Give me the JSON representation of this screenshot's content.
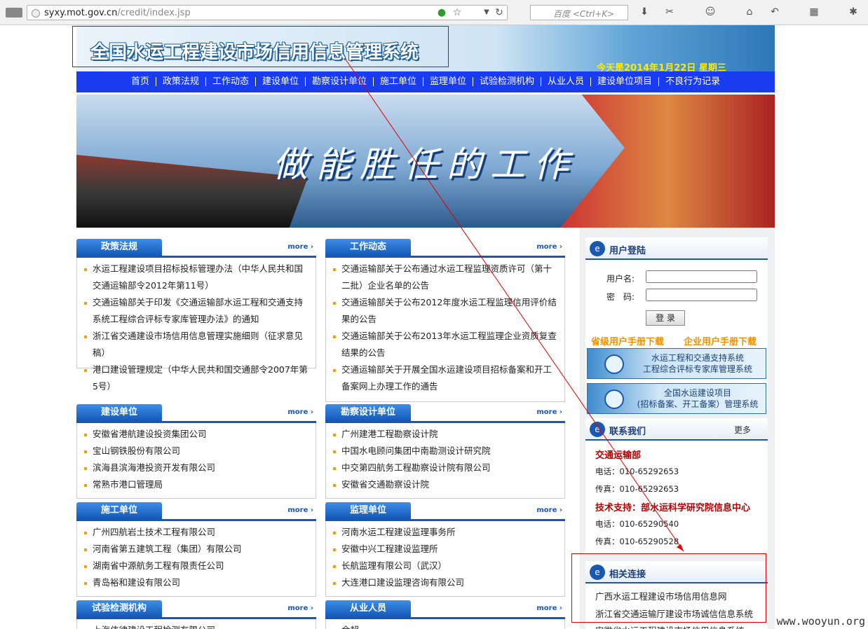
{
  "browser": {
    "url_host": "syxy.mot.gov.cn",
    "url_path": "/credit/index.jsp",
    "search_placeholder": "百度 <Ctrl+K>"
  },
  "header": {
    "title": "全国水运工程建设市场信用信息管理系统",
    "date": "今天是2014年1月22日 星期三"
  },
  "nav": [
    "首页",
    "政策法规",
    "工作动态",
    "建设单位",
    "勘察设计单位",
    "施工单位",
    "监理单位",
    "试验检测机构",
    "从业人员",
    "建设单位项目",
    "不良行为记录"
  ],
  "banner": {
    "slogan": "做能胜任的工作"
  },
  "more_label": "more ›",
  "sections": {
    "policy": {
      "title": "政策法规",
      "items": [
        "水运工程建设项目招标投标管理办法（中华人民共和国交通运输部令2012年第11号）",
        "交通运输部关于印发《交通运输部水运工程和交通支持系统工程综合评标专家库管理办法》的通知",
        "浙江省交通建设市场信用信息管理实施细则（征求意见稿）",
        "港口建设管理规定（中华人民共和国交通部令2007年第5号）"
      ]
    },
    "news": {
      "title": "工作动态",
      "items": [
        "交通运输部关于公布通过水运工程监理资质许可（第十二批）企业名单的公告",
        "交通运输部关于公布2012年度水运工程监理信用评价结果的公告",
        "交通运输部关于公布2013年水运工程监理企业资质复查结果的公告",
        "交通运输部关于开展全国水运建设项目招标备案和开工备案网上办理工作的通告"
      ]
    },
    "build": {
      "title": "建设单位",
      "items": [
        "安徽省港航建设投资集团公司",
        "宝山钢铁股份有限公司",
        "滨海县滨海港投资开发有限公司",
        "常熟市港口管理局"
      ]
    },
    "survey": {
      "title": "勘察设计单位",
      "items": [
        "广州建港工程勘察设计院",
        "中国水电顾问集团中南勘测设计研究院",
        "中交第四航务工程勘察设计院有限公司",
        "安徽省交通勘察设计院"
      ]
    },
    "construct": {
      "title": "施工单位",
      "items": [
        "广州四航岩土技术工程有限公司",
        "河南省第五建筑工程（集团）有限公司",
        "湖南省中源航务工程有限责任公司",
        "青岛裕和建设有限公司"
      ]
    },
    "supervise": {
      "title": "监理单位",
      "items": [
        "河南水运工程建设监理事务所",
        "安徽中兴工程建设监理所",
        "长航监理有限公司（武汉）",
        "大连港口建设监理咨询有限公司"
      ]
    },
    "testing": {
      "title": "试验检测机构",
      "items": [
        "上海伟律建设工程检测有限公司"
      ]
    },
    "staff": {
      "title": "从业人员",
      "items": [
        "余超"
      ]
    }
  },
  "login": {
    "title": "用户登陆",
    "username_label": "用户名:",
    "password_label": "密　码:",
    "button": "登 录",
    "dl1": "省级用户手册下载",
    "dl2": "企业用户手册下载",
    "promo1_line1": "水运工程和交通支持系统",
    "promo1_line2": "工程综合评标专家库管理系统",
    "promo2_line1": "全国水运建设项目",
    "promo2_line2": "(招标备案、开工备案）管理系统"
  },
  "contact": {
    "title": "联系我们",
    "more": "更多",
    "org": "交通运输部",
    "tel1": "电话：010-65292653",
    "fax1": "传真：010-65292653",
    "support": "技术支持：部水运科学研究院信息中心",
    "tel2": "电话：010-65290540",
    "fax2": "传真：010-65290528"
  },
  "links": {
    "title": "相关连接",
    "items": [
      "广西水运工程建设市场信用信息网",
      "浙江省交通运输厅建设市场诚信信息系统",
      "安徽省水运工程建设市场信用信息系统"
    ]
  },
  "watermark": "www.wooyun.org",
  "colors": {
    "nav": "#1a3cf0",
    "accent": "#1a58b0",
    "highlight": "#e00000"
  }
}
